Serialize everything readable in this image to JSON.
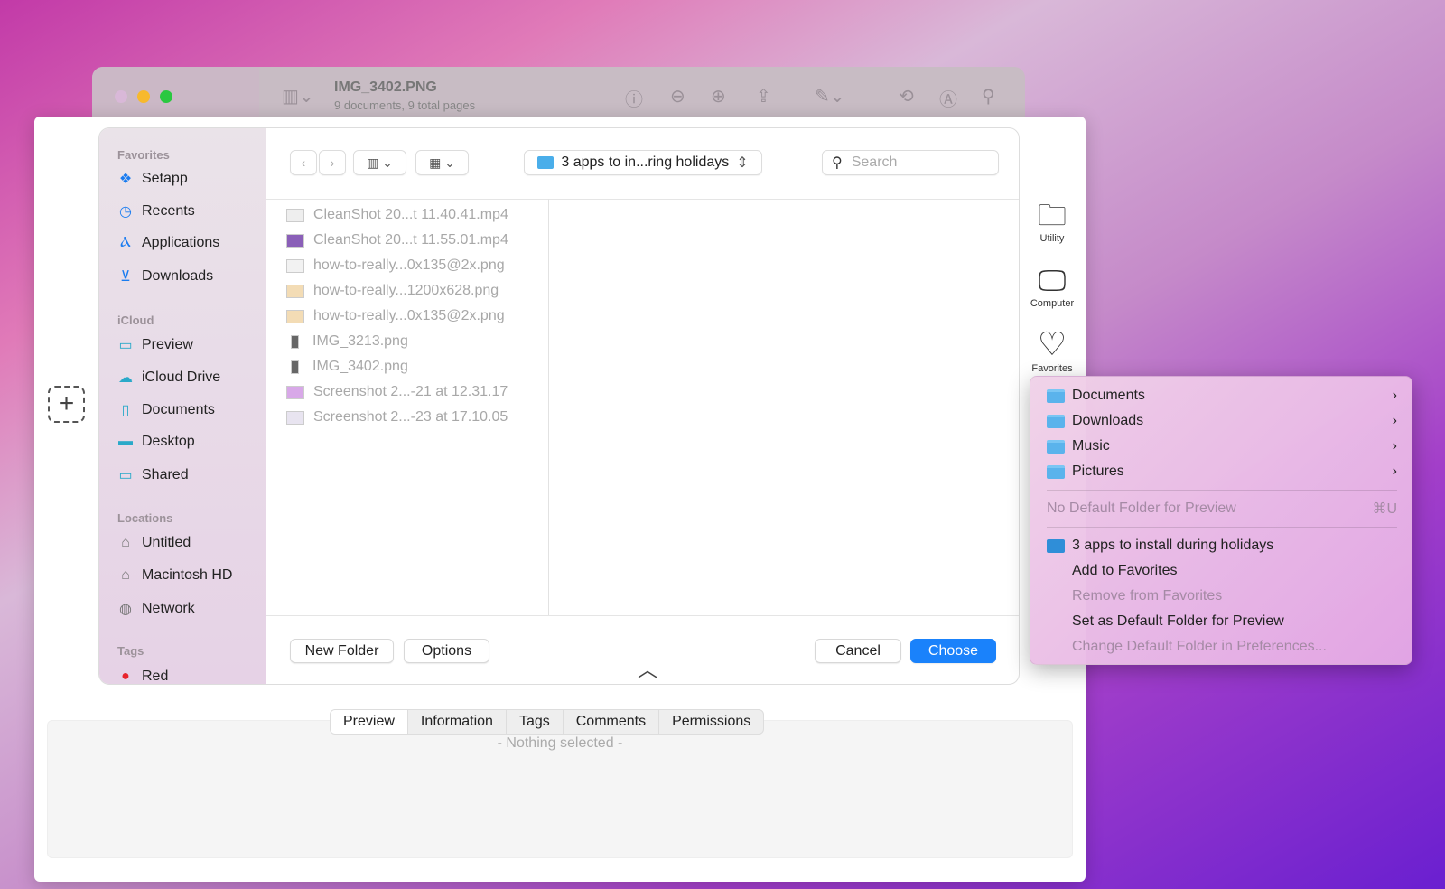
{
  "background_window": {
    "title": "IMG_3402.PNG",
    "subtitle": "9 documents, 9 total pages"
  },
  "sidebar": {
    "sections": [
      {
        "header": "Favorites",
        "items": [
          {
            "label": "Setapp",
            "icon": "setapp-icon"
          },
          {
            "label": "Recents",
            "icon": "clock-icon"
          },
          {
            "label": "Applications",
            "icon": "applications-icon"
          },
          {
            "label": "Downloads",
            "icon": "download-icon"
          }
        ]
      },
      {
        "header": "iCloud",
        "items": [
          {
            "label": "Preview",
            "icon": "folder-icon"
          },
          {
            "label": "iCloud Drive",
            "icon": "cloud-icon"
          },
          {
            "label": "Documents",
            "icon": "document-icon"
          },
          {
            "label": "Desktop",
            "icon": "desktop-icon"
          },
          {
            "label": "Shared",
            "icon": "shared-folder-icon"
          }
        ]
      },
      {
        "header": "Locations",
        "items": [
          {
            "label": "Untitled",
            "icon": "drive-icon"
          },
          {
            "label": "Macintosh HD",
            "icon": "drive-icon"
          },
          {
            "label": "Network",
            "icon": "network-icon"
          }
        ]
      },
      {
        "header": "Tags",
        "items": [
          {
            "label": "Red",
            "icon": "red-tag-dot"
          }
        ]
      }
    ]
  },
  "toolbar": {
    "path": "3 apps to in...ring holidays",
    "search_placeholder": "Search"
  },
  "files": [
    "CleanShot 20...t 11.40.41.mp4",
    "CleanShot 20...t 11.55.01.mp4",
    "how-to-really...0x135@2x.png",
    "how-to-really...1200x628.png",
    "how-to-really...0x135@2x.png",
    "IMG_3213.png",
    "IMG_3402.png",
    "Screenshot 2...-21 at 12.31.17",
    "Screenshot 2...-23 at 17.10.05"
  ],
  "buttons": {
    "new_folder": "New Folder",
    "options": "Options",
    "cancel": "Cancel",
    "choose": "Choose"
  },
  "right_icons": {
    "utility": "Utility",
    "computer": "Computer",
    "favorites": "Favorites"
  },
  "menu": {
    "folders": [
      "Documents",
      "Downloads",
      "Music",
      "Pictures"
    ],
    "no_default": "No Default Folder for Preview",
    "no_default_shortcut": "⌘U",
    "current": "3 apps to install during holidays",
    "add": "Add to Favorites",
    "remove": "Remove from Favorites",
    "set_default": "Set as Default Folder for Preview",
    "change_default": "Change Default Folder in Preferences..."
  },
  "tabs": [
    "Preview",
    "Information",
    "Tags",
    "Comments",
    "Permissions"
  ],
  "info": {
    "empty": "- Nothing selected -"
  },
  "colors": {
    "accent": "#1a7cf0",
    "choose_button": "#1a82fb",
    "tag_red": "#e8242c"
  }
}
